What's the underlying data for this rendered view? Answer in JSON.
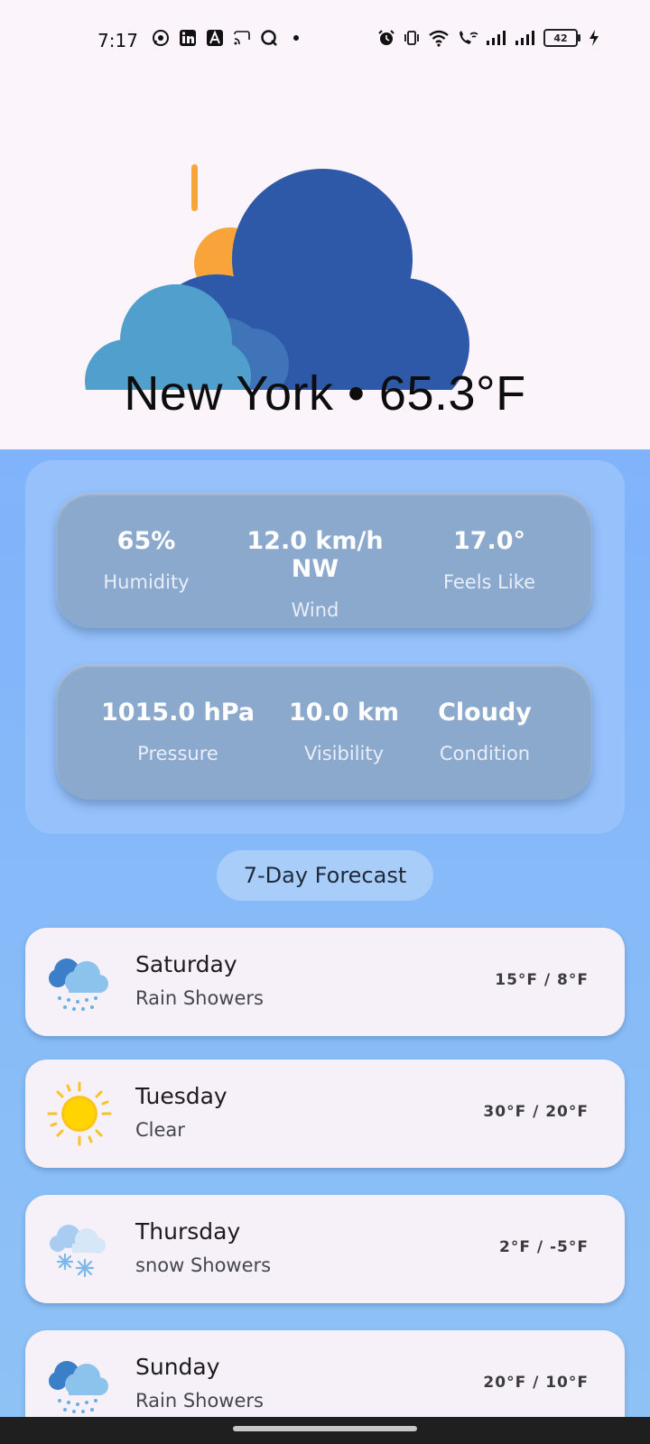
{
  "status_bar": {
    "time": "7:17",
    "battery": "42",
    "left_icons": [
      "whatsapp-icon",
      "linkedin-icon",
      "a-app-icon",
      "cast-icon",
      "q-app-icon",
      "dot-icon"
    ],
    "right_icons": [
      "alarm-icon",
      "vibrate-icon",
      "wifi-icon",
      "wifi-call-icon",
      "signal-icon",
      "signal-icon",
      "battery-icon",
      "charging-icon"
    ]
  },
  "header": {
    "location_temp": "New York • 65.3°F",
    "settings_icon": "gear-icon"
  },
  "stats": {
    "row1": [
      {
        "value": "65%",
        "label": "Humidity"
      },
      {
        "value": "12.0 km/h NW",
        "label": "Wind"
      },
      {
        "value": "17.0°",
        "label": "Feels Like"
      }
    ],
    "row2": [
      {
        "value": "1015.0 hPa",
        "label": "Pressure"
      },
      {
        "value": "10.0 km",
        "label": "Visibility"
      },
      {
        "value": "Cloudy",
        "label": "Condition"
      }
    ]
  },
  "forecast": {
    "title": "7-Day Forecast",
    "days": [
      {
        "day": "Saturday",
        "condition": "Rain Showers",
        "temp": "15°F / 8°F",
        "icon": "rain-cloud-icon"
      },
      {
        "day": "Tuesday",
        "condition": "Clear",
        "temp": "30°F / 20°F",
        "icon": "sun-icon"
      },
      {
        "day": "Thursday",
        "condition": "snow Showers",
        "temp": "2°F / -5°F",
        "icon": "snow-cloud-icon"
      },
      {
        "day": "Sunday",
        "condition": "Rain Showers",
        "temp": "20°F / 10°F",
        "icon": "rain-cloud-icon"
      }
    ]
  },
  "colors": {
    "background_top": "#fbf4fa",
    "main_gradient_start": "#7fb3fb",
    "panel": "#96c1fb",
    "stat_card": "#8ba8cd",
    "forecast_card": "#f6f1f8",
    "cloud_dark": "#2e58a8",
    "cloud_light": "#519fcc",
    "sun": "#f9a43a"
  }
}
